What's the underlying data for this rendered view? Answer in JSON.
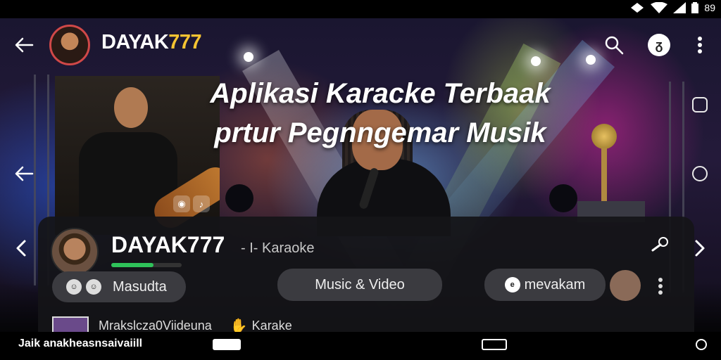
{
  "status_bar": {
    "battery_text": "89"
  },
  "app_bar": {
    "title_part1": "DAYAK",
    "title_part2": "777",
    "icons": [
      "back-arrow-icon",
      "search-icon",
      "profile-icon",
      "more-vert-icon"
    ],
    "profile_glyph": "ᵹ"
  },
  "hero": {
    "headline_line1": "Aplikasi Karacke Terbaak",
    "headline_line2": "prtur Pegnngemar Musik"
  },
  "sheet": {
    "title": "DAYAK777",
    "subtitle": "- I- Karaoke",
    "progress_fraction": 0.6,
    "chip_left_label": "Masudta",
    "chip_left_icons": [
      "chip-icon-1",
      "chip-icon-2"
    ],
    "center_pill_label": "Music & Video",
    "right_pill_label": "mevakam",
    "right_pill_icon_glyph": "e",
    "row_label": "Mrakslcza0Viideuna",
    "row_action_label": "Karake"
  },
  "bottom_bar": {
    "text": "Jaik anakheasnsaivaiill"
  },
  "colors": {
    "accent_yellow": "#f6c432",
    "progress_green": "#2fc25a",
    "avatar_ring": "#d04848"
  }
}
